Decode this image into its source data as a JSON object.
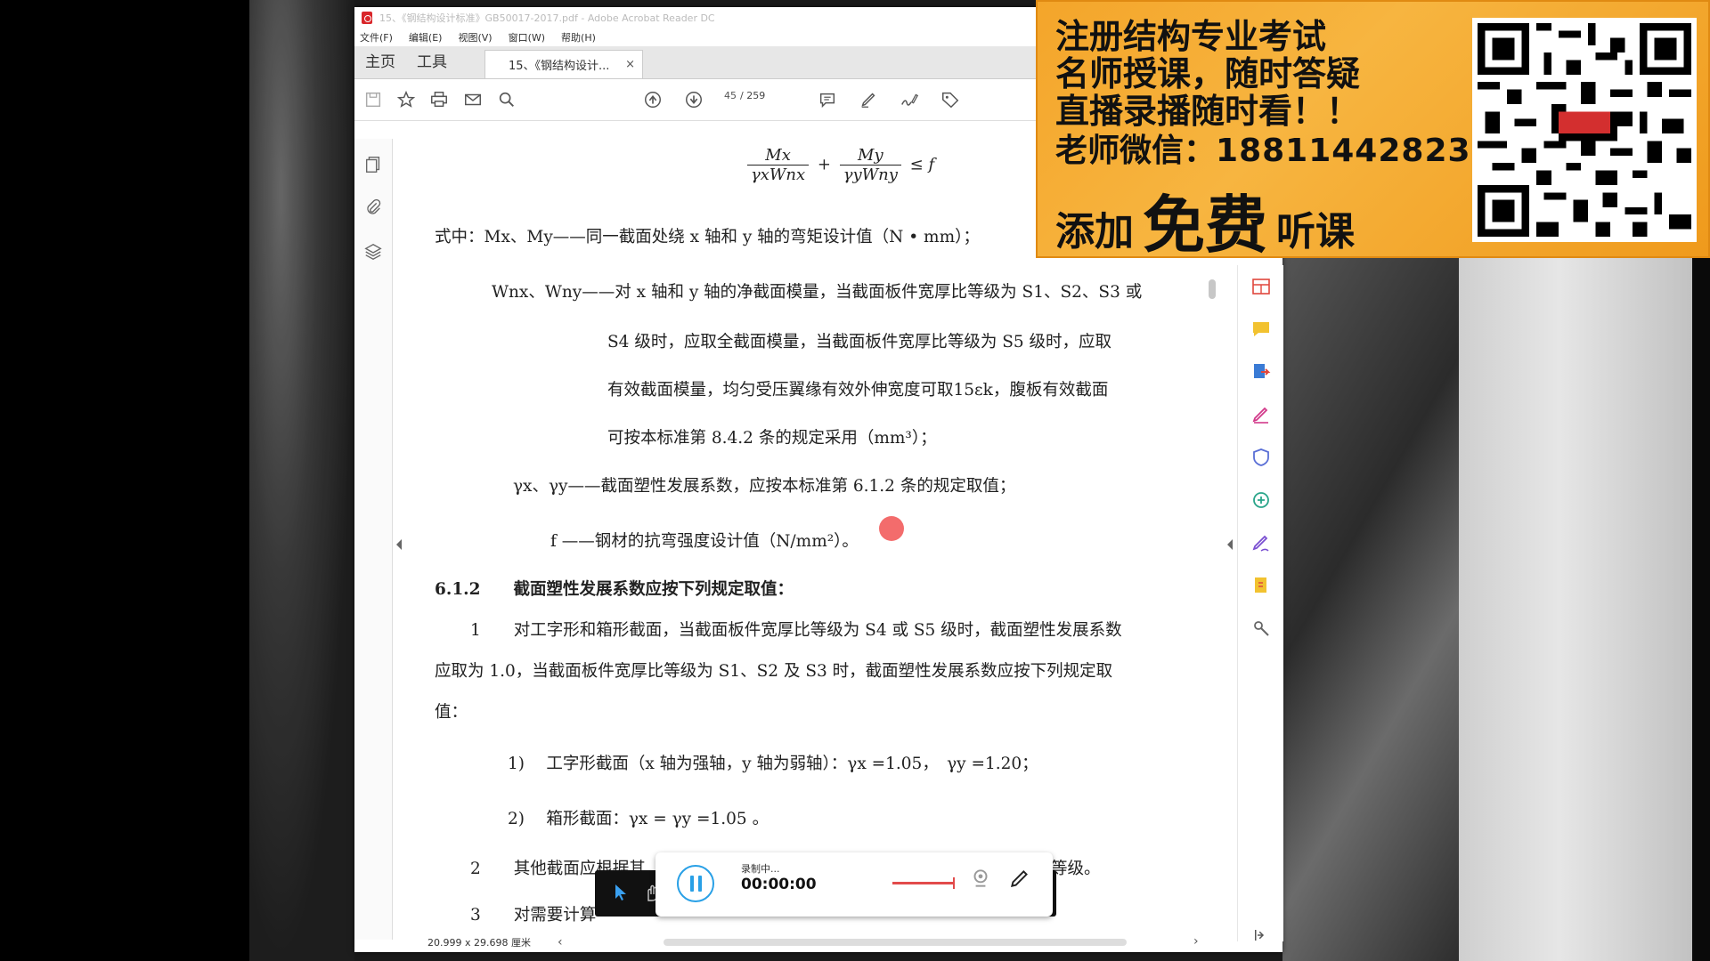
{
  "window": {
    "title": "15、《钢结构设计标准》GB50017-2017.pdf - Adobe Acrobat Reader DC"
  },
  "menu": [
    "文件(F)",
    "编辑(E)",
    "视图(V)",
    "窗口(W)",
    "帮助(H)"
  ],
  "tabs": {
    "home": "主页",
    "tools": "工具",
    "document": "15、《钢结构设计...",
    "close": "×"
  },
  "toolbar": {
    "page_current": "45",
    "page_total": "/ 259"
  },
  "document": {
    "formula": {
      "num1": "Mx",
      "den1": "γxWnx",
      "plus": "+",
      "num2": "My",
      "den2": "γyWny",
      "leq": "≤ f"
    },
    "lines": [
      "式中：Mx、My——同一截面处绕 x 轴和 y 轴的弯矩设计值（N • mm）；",
      "Wnx、Wny——对 x 轴和 y 轴的净截面模量，当截面板件宽厚比等级为 S1、S2、S3 或",
      "S4 级时，应取全截面模量，当截面板件宽厚比等级为 S5 级时，应取",
      "有效截面模量，均匀受压翼缘有效外伸宽度可取15εk，腹板有效截面",
      "可按本标准第 8.4.2 条的规定采用（mm³）；",
      "γx、γy——截面塑性发展系数，应按本标准第 6.1.2 条的规定取值；",
      "f ——钢材的抗弯强度设计值（N/mm²）。",
      "6.1.2　　截面塑性发展系数应按下列规定取值：",
      "1　　对工字形和箱形截面，当截面板件宽厚比等级为 S4 或 S5 级时，截面塑性发展系数",
      "应取为 1.0，当截面板件宽厚比等级为 S1、S2 及 S3 时，截面塑性发展系数应按下列规定取",
      "值：",
      "1)　 工字形截面（x 轴为强轴，y 轴为弱轴）：γx =1.05，　γy =1.20；",
      "2)　 箱形截面：γx = γy =1.05 。",
      "2　　其他截面应根据其",
      "等级。",
      "3　　对需要计算"
    ]
  },
  "statusbar": {
    "page_size": "20.999 x 29.698 厘米"
  },
  "recorder": {
    "status": "录制中...",
    "time": "00:00:00"
  },
  "ad": {
    "line1": "注册结构专业考试",
    "line2": "名师授课，随时答疑",
    "line3": "直播录播随时看！！",
    "line4_label": "老师微信：",
    "line4_phone": "18811442823",
    "line5_a": "添加",
    "line5_b": "免费",
    "line5_c": "听课"
  },
  "colors": {
    "ad_bg": "#f4a52a",
    "accent_blue": "#29a0e6",
    "cursor_red": "#f26464",
    "pdf_red": "#d9262a"
  }
}
